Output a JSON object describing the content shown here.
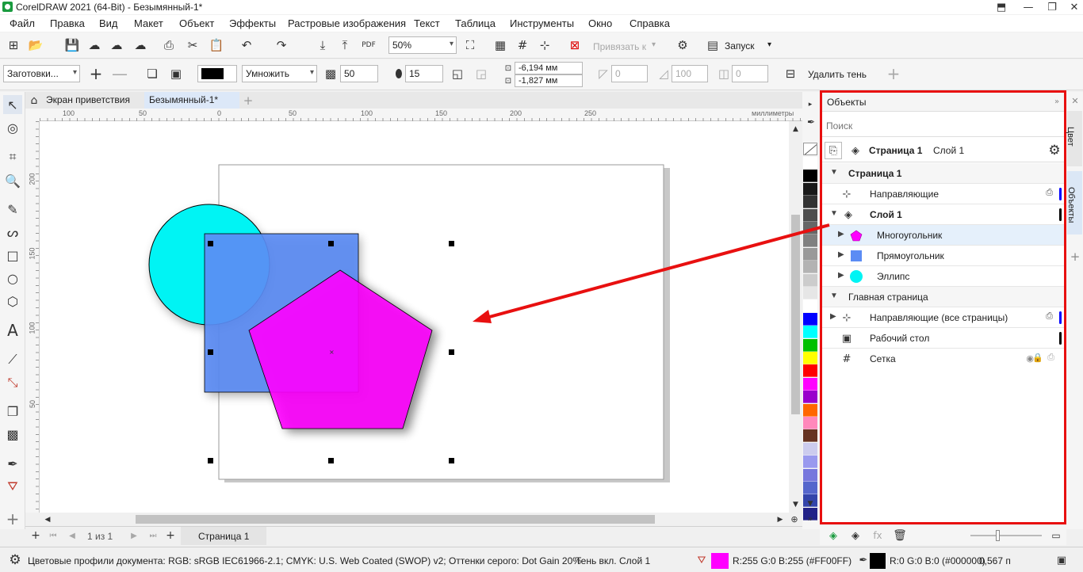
{
  "window": {
    "title": "CorelDRAW 2021 (64-Bit) - Безымянный-1*"
  },
  "menu": [
    "Файл",
    "Правка",
    "Вид",
    "Макет",
    "Объект",
    "Эффекты",
    "Растровые изображения",
    "Текст",
    "Таблица",
    "Инструменты",
    "Окно",
    "Справка"
  ],
  "toolbar1": {
    "zoom": "50%",
    "snap_to": "Привязать к",
    "launch": "Запуск"
  },
  "toolbar2": {
    "presets": "Заготовки...",
    "merge_mode": "Умножить",
    "opacity": "50",
    "feather": "15",
    "x_offset": "-6,194 мм",
    "y_offset": "-1,827 мм",
    "val_a": "0",
    "val_b": "100",
    "val_c": "0",
    "remove_shadow": "Удалить тень"
  },
  "tabs": {
    "welcome": "Экран приветствия",
    "document": "Безымянный-1*"
  },
  "ruler": {
    "h_marks": [
      "100",
      "50",
      "0",
      "50",
      "100",
      "150",
      "200",
      "250"
    ],
    "v_marks": [
      "200",
      "150",
      "100",
      "50"
    ],
    "unit": "миллиметры"
  },
  "pagenav": {
    "counter": "1 из 1",
    "page_tab": "Страница 1"
  },
  "palette": [
    "#ffffff",
    "#000000",
    "#1a1a1a",
    "#333333",
    "#4d4d4d",
    "#666666",
    "#808080",
    "#999999",
    "#b3b3b3",
    "#cccccc",
    "#e6e6e6",
    "#ffffff",
    "#0000ff",
    "#00ffff",
    "#00c000",
    "#ffff00",
    "#ff0000",
    "#ff00ff",
    "#9900cc",
    "#ff6600",
    "#ff88bb",
    "#663322",
    "#ccccee",
    "#9999ee",
    "#7777dd",
    "#5566cc",
    "#3344aa",
    "#222288"
  ],
  "docker": {
    "title": "Объекты",
    "search_placeholder": "Поиск",
    "page_label": "Страница 1",
    "layer_label": "Слой 1",
    "rows": {
      "page": "Страница 1",
      "guides": "Направляющие",
      "layer": "Слой 1",
      "polygon": "Многоугольник",
      "rectangle": "Прямоугольник",
      "ellipse": "Эллипс",
      "master": "Главная страница",
      "master_guides": "Направляющие (все страницы)",
      "desktop": "Рабочий стол",
      "grid": "Сетка"
    },
    "side_tabs": {
      "color": "Цвет",
      "objects": "Объекты"
    }
  },
  "status": {
    "color_profiles": "Цветовые профили документа: RGB: sRGB IEC61966-2.1; CMYK: U.S. Web Coated (SWOP) v2; Оттенки серого: Dot Gain 20%",
    "shadow_info": "Тень вкл. Слой 1",
    "fill": "R:255 G:0 B:255 (#FF00FF)",
    "outline": "R:0 G:0 B:0 (#000000)",
    "outline_width": "0,567 п"
  },
  "colors": {
    "fill": "#ff00ff",
    "highlight": "#e81010",
    "ellipse": "#00f4f4",
    "rectangle": "#5b8cf4"
  }
}
